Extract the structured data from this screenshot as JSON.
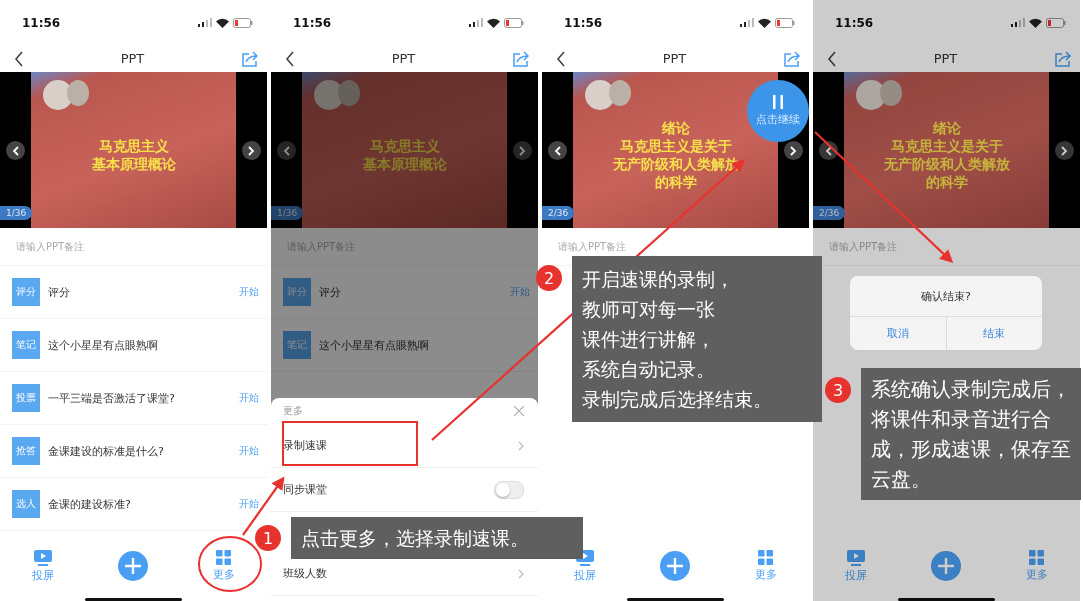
{
  "screens": [
    {
      "time": "11:56",
      "title": "PPT",
      "slide": {
        "lines": [
          "马克思主义",
          "基本原理概论"
        ],
        "page": "1/36"
      },
      "note_placeholder": "请输入PPT备注",
      "items": [
        {
          "tag": "评分",
          "text": "评分",
          "action": "开始"
        },
        {
          "tag": "笔记",
          "text": "这个小星星有点眼熟啊"
        },
        {
          "tag": "投票",
          "text": "一平三端是否激活了课堂?",
          "action": "开始"
        },
        {
          "tag": "抢答",
          "text": "金课建设的标准是什么?",
          "action": "开始"
        },
        {
          "tag": "选人",
          "text": "金课的建设标准?",
          "action": "开始"
        }
      ],
      "toolbar": [
        {
          "kind": "screen",
          "label": "投屏"
        },
        {
          "kind": "add"
        },
        {
          "kind": "more",
          "label": "更多"
        }
      ]
    },
    {
      "time": "11:56",
      "title": "PPT",
      "slide": {
        "lines": [
          "马克思主义",
          "基本原理概论"
        ],
        "page": "1/36"
      },
      "note_placeholder": "请输入PPT备注",
      "dimmed": true,
      "items": [
        {
          "tag": "评分",
          "text": "评分",
          "action": "开始"
        },
        {
          "tag": "笔记",
          "text": "这个小星星有点眼熟啊"
        }
      ],
      "sheet": {
        "title": "更多",
        "items": [
          {
            "kind": "link",
            "label": "录制速课"
          },
          {
            "kind": "toggle",
            "label": "同步课堂",
            "on": false
          },
          {
            "kind": "link",
            "label": "班级人数"
          }
        ]
      }
    },
    {
      "time": "11:56",
      "title": "PPT",
      "slide": {
        "lines": [
          "绪论",
          "马克思主义是关于",
          "无产阶级和人类解放",
          "的科学"
        ],
        "page": "2/36"
      },
      "note_placeholder": "请输入PPT备注",
      "recording": {
        "label": "点击继续"
      },
      "toolbar": [
        {
          "kind": "screen",
          "label": "投屏"
        },
        {
          "kind": "add"
        },
        {
          "kind": "more",
          "label": "更多"
        }
      ]
    },
    {
      "time": "11:56",
      "title": "PPT",
      "slide": {
        "lines": [
          "绪论",
          "马克思主义是关于",
          "无产阶级和人类解放",
          "的科学"
        ],
        "page": "2/36"
      },
      "note_placeholder": "请输入PPT备注",
      "dimmed": true,
      "dialog": {
        "message": "确认结束?",
        "buttons": [
          "取消",
          "结束"
        ]
      },
      "toolbar": [
        {
          "kind": "screen",
          "label": "投屏"
        },
        {
          "kind": "add"
        },
        {
          "kind": "more",
          "label": "更多"
        }
      ]
    }
  ],
  "callouts": [
    {
      "number": "1",
      "lines": [
        "点击更多，选择录制速课。"
      ]
    },
    {
      "number": "2",
      "lines": [
        "开启速课的录制，",
        "教师可对每一张",
        "课件进行讲解，",
        "系统自动记录。",
        "录制完成后选择结束。"
      ]
    },
    {
      "number": "3",
      "lines": [
        "系统确认录制完成后，将课件和录音进行合成，形成速课，保存至云盘。"
      ]
    }
  ]
}
